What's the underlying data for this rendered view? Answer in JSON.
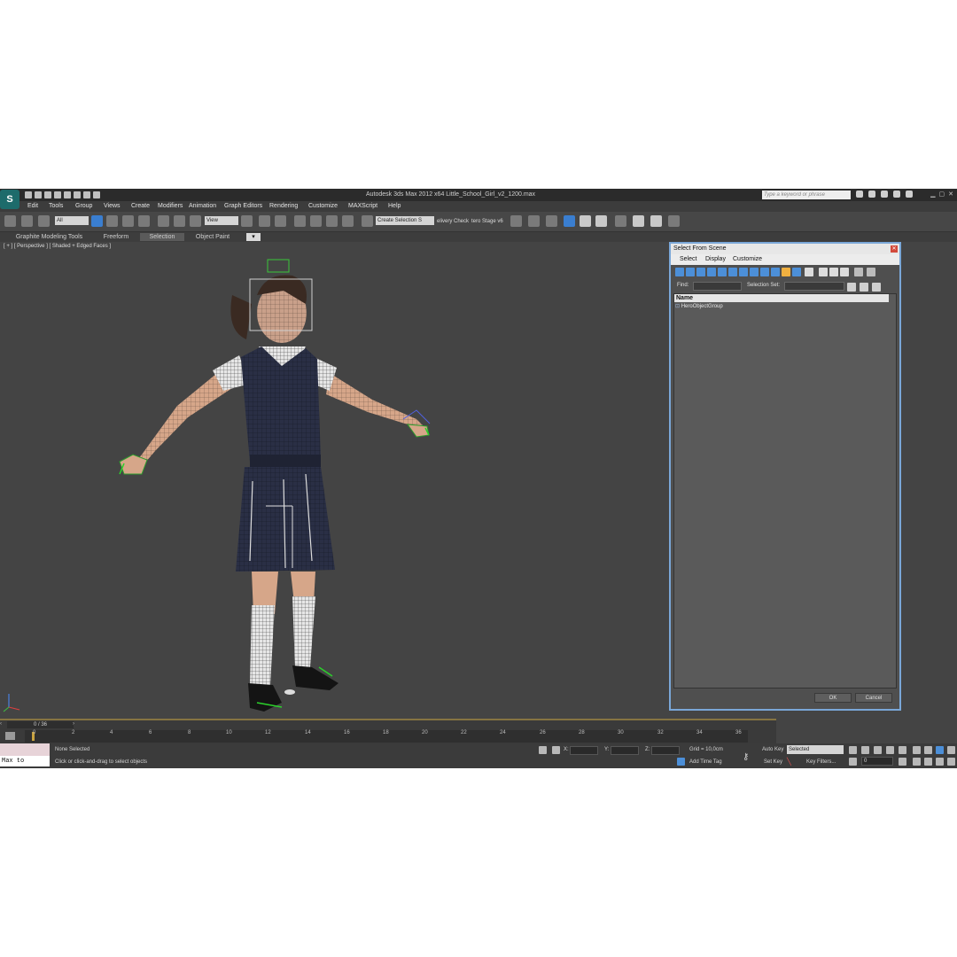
{
  "window": {
    "title": "Autodesk 3ds Max  2012 x64     Little_School_Girl_v2_1200.max",
    "search_placeholder": "Type a keyword or phrase"
  },
  "menu": [
    "Edit",
    "Tools",
    "Group",
    "Views",
    "Create",
    "Modifiers",
    "Animation",
    "Graph Editors",
    "Rendering",
    "Customize",
    "MAXScript",
    "Help"
  ],
  "toolbar": {
    "filter_value": "All",
    "coord_value": "View",
    "selection_set": "Create Selection S",
    "delivery_check": "elivery Check",
    "hero_stage": "tero Stage v6"
  },
  "ribbon_tabs": [
    "Graphite Modeling Tools",
    "Freeform",
    "Selection",
    "Object Paint"
  ],
  "viewport": {
    "label": "[ + ] [ Perspective ] [ Shaded + Edged Faces ]"
  },
  "dialog": {
    "title": "Select From Scene",
    "menu": [
      "Select",
      "Display",
      "Customize"
    ],
    "find_label": "Find:",
    "selection_set_label": "Selection Set:",
    "column_header": "Name",
    "items": [
      "HeroObjectGroup"
    ],
    "ok": "OK",
    "cancel": "Cancel"
  },
  "timeline": {
    "frame_counter": "0 / 36",
    "ticks": [
      "0",
      "2",
      "4",
      "6",
      "8",
      "10",
      "12",
      "14",
      "16",
      "18",
      "20",
      "22",
      "24",
      "26",
      "28",
      "30",
      "32",
      "34",
      "36"
    ]
  },
  "status": {
    "maxscript_label": "Max to Physc.",
    "selection_info": "None Selected",
    "prompt": "Click or click-and-drag to select objects",
    "x_label": "X:",
    "y_label": "Y:",
    "z_label": "Z:",
    "grid": "Grid = 10,0cm",
    "add_time_tag": "Add Time Tag",
    "auto_key": "Auto Key",
    "auto_key_mode": "Selected",
    "set_key": "Set Key",
    "key_filters": "Key Filters...",
    "current_frame": "0"
  },
  "colors": {
    "accent": "#3a7ed0",
    "viewport_bg": "#444444",
    "dialog_border": "#7aa7d8"
  }
}
